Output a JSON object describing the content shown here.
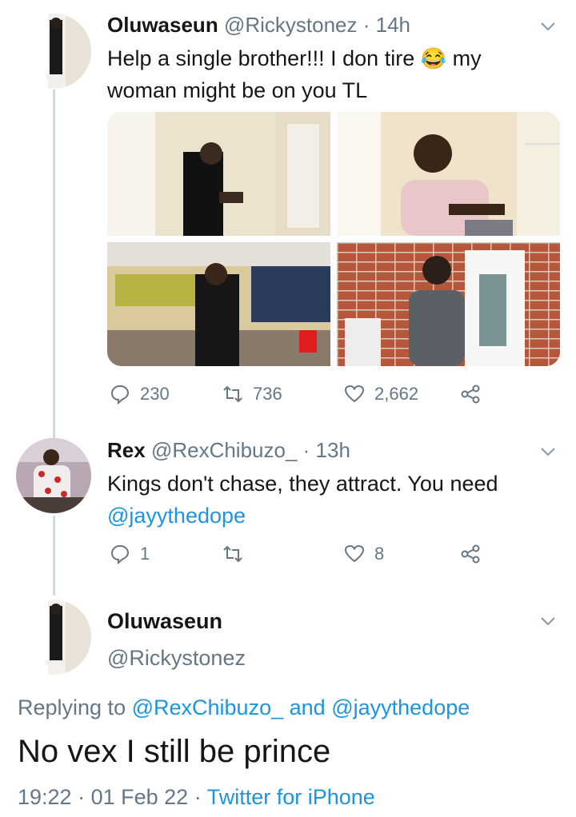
{
  "tweet1": {
    "name": "Oluwaseun",
    "handle": "@Rickystonez",
    "time": "· 14h",
    "text_line1_a": "Help a single brother!!! I don tire",
    "emoji": "😂",
    "text_line1_b": "my",
    "text_line2": "woman might be on you TL",
    "media": [
      "photo-man-black-outfit",
      "photo-man-pink-shirt",
      "photo-man-in-shop",
      "photo-man-grey-sweater"
    ],
    "replies": "230",
    "retweets": "736",
    "likes": "2,662"
  },
  "tweet2": {
    "name": "Rex",
    "handle": "@RexChibuzo_",
    "time": "· 13h",
    "text_line1": "Kings don't chase, they attract. You need",
    "mention": "@jayythedope",
    "replies": "1",
    "likes": "8"
  },
  "focus": {
    "name": "Oluwaseun",
    "handle": "@Rickystonez",
    "replying_prefix": "Replying to",
    "replying_to_1": "@RexChibuzo_",
    "replying_and": "and",
    "replying_to_2": "@jayythedope",
    "text": "No vex I still be prince",
    "time": "19:22",
    "date": "01 Feb 22",
    "source": "Twitter for iPhone"
  },
  "colors": {
    "link": "#1b95e0",
    "secondary": "#657786",
    "thread_line": "#cfd9de"
  }
}
